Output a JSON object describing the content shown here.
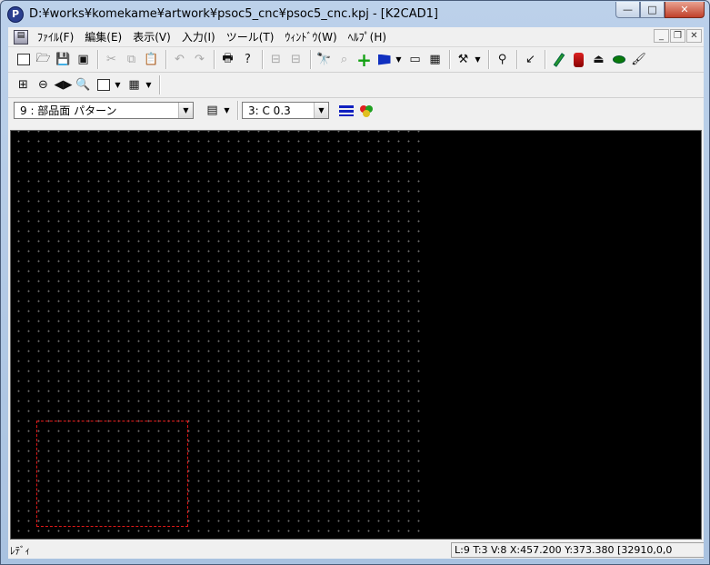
{
  "window": {
    "title": "D:¥works¥komekame¥artwork¥psoc5_cnc¥psoc5_cnc.kpj - [K2CAD1]",
    "app_icon_glyph": "P",
    "controls": {
      "minimize": "—",
      "maximize": "□",
      "close": "✕"
    }
  },
  "menubar": {
    "items": [
      {
        "label": "ﾌｧｲﾙ(F)"
      },
      {
        "label": "編集(E)"
      },
      {
        "label": "表示(V)"
      },
      {
        "label": "入力(I)"
      },
      {
        "label": "ツール(T)"
      },
      {
        "label": "ｳｨﾝﾄﾞｳ(W)"
      },
      {
        "label": "ﾍﾙﾌﾟ(H)"
      }
    ],
    "mdi_controls": {
      "minimize": "_",
      "restore": "❐",
      "close": "✕"
    }
  },
  "toolbar1": {
    "icons": [
      "new-file-icon",
      "open-folder-icon",
      "save-icon",
      "save-all-icon",
      "cut-icon",
      "copy-icon",
      "paste-icon",
      "undo-icon",
      "redo-icon",
      "print-icon",
      "help-icon",
      "grid-a-icon",
      "grid-b-icon",
      "binoculars-icon",
      "find-replace-icon",
      "add-part-icon",
      "flag-icon",
      "screen-icon",
      "calendar-icon",
      "hammer-icon",
      "lasso-icon",
      "pointer-icon",
      "pencil-icon",
      "layers-icon",
      "iron-icon",
      "ellipse-icon",
      "brush-icon"
    ]
  },
  "toolbar3": {
    "layer_combo": {
      "value": "9 : 部品面 パターン"
    },
    "pen_combo": {
      "value": "3: C 0.3"
    }
  },
  "statusbar": {
    "left": "ﾚﾃﾞｨ",
    "right": "L:9 T:3 V:8 X:457.200 Y:373.380 [32910,0,0"
  },
  "colors": {
    "canvas_bg": "#000000",
    "grid_dot": "#6e6e6e",
    "part_outline": "#e01818"
  }
}
